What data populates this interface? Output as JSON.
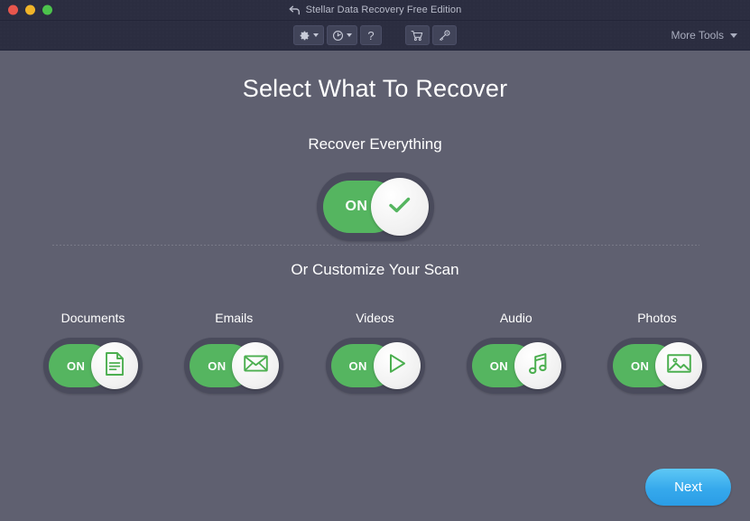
{
  "titlebar": {
    "title": "Stellar Data Recovery Free Edition",
    "back_icon": "back-arrow-icon",
    "traffic_lights": [
      {
        "name": "close",
        "color": "#e8564d"
      },
      {
        "name": "minimize",
        "color": "#f0b429"
      },
      {
        "name": "maximize",
        "color": "#4cc34c"
      }
    ]
  },
  "toolbar": {
    "buttons": [
      {
        "name": "settings",
        "icon": "gear-icon",
        "has_caret": true
      },
      {
        "name": "history",
        "icon": "clock-history-icon",
        "has_caret": true
      },
      {
        "name": "help",
        "icon": "question-mark-icon",
        "label": "?",
        "has_caret": false
      },
      {
        "name": "buy",
        "icon": "shopping-cart-icon",
        "has_caret": false
      },
      {
        "name": "activate",
        "icon": "key-icon",
        "has_caret": false
      }
    ],
    "more_tools_label": "More Tools"
  },
  "main": {
    "page_title": "Select What To Recover",
    "recover_everything_label": "Recover Everything",
    "customize_label": "Or Customize Your Scan",
    "master_toggle": {
      "name": "recover-everything",
      "state_label": "ON",
      "enabled": true,
      "icon": "check-icon"
    },
    "categories": [
      {
        "name": "documents",
        "label": "Documents",
        "state_label": "ON",
        "enabled": true,
        "icon": "document-icon"
      },
      {
        "name": "emails",
        "label": "Emails",
        "state_label": "ON",
        "enabled": true,
        "icon": "envelope-icon"
      },
      {
        "name": "videos",
        "label": "Videos",
        "state_label": "ON",
        "enabled": true,
        "icon": "play-icon"
      },
      {
        "name": "audio",
        "label": "Audio",
        "state_label": "ON",
        "enabled": true,
        "icon": "music-note-icon"
      },
      {
        "name": "photos",
        "label": "Photos",
        "state_label": "ON",
        "enabled": true,
        "icon": "image-icon"
      }
    ],
    "next_label": "Next"
  },
  "colors": {
    "background": "#5f6070",
    "chrome": "#2b2d40",
    "toggle_track": "#4a4b5c",
    "toggle_on_green": "#55b560",
    "accent_blue": "#36a9ec",
    "text_primary": "#ffffff",
    "text_muted": "#a9adbe"
  }
}
